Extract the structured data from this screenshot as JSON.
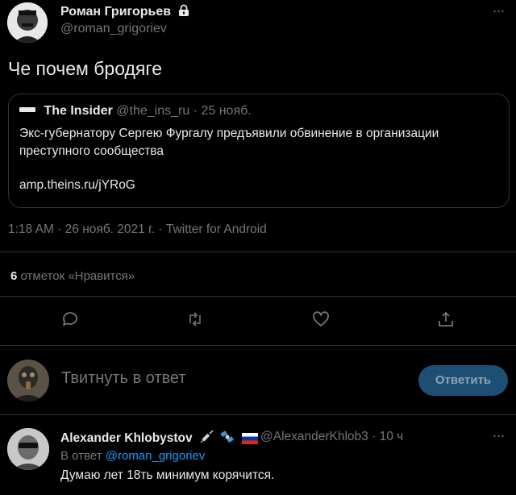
{
  "tweet": {
    "author_name": "Роман Григорьев",
    "author_handle": "@roman_grigoriev",
    "text": "Че почем бродяге",
    "quote": {
      "name": "The Insider",
      "handle": "@the_ins_ru",
      "date": "25 нояб.",
      "text": "Экс-губернатору Сергею Фургалу предъявили обвинение в организации преступного сообщества",
      "link": "amp.theins.ru/jYRoG"
    },
    "timestamp": "1:18 AM · 26 нояб. 2021 г. · Twitter for Android",
    "likes_count": "6",
    "likes_label": "отметок «Нравится»",
    "icons": {
      "lock": "lock-icon",
      "more": "more-icon",
      "reply": "reply-icon",
      "retweet": "retweet-icon",
      "like": "like-icon",
      "share": "share-icon"
    }
  },
  "composer": {
    "placeholder": "Твитнуть в ответ",
    "button_label": "Ответить",
    "button_color": "#1d4f74"
  },
  "reply": {
    "author_name": "Alexander Khlobystov",
    "author_handle": "@AlexanderKhlob3",
    "time": "10 ч",
    "reply_to_prefix": "В ответ",
    "reply_to_handle": "@roman_grigoriev",
    "text": "Думаю лет 18ть минимум корячится.",
    "emojis": [
      "syringe-emoji",
      "satellite-emoji",
      "russia-flag-emoji"
    ]
  },
  "colors": {
    "background": "#000000",
    "text": "#e7e9ea",
    "secondary": "#71767b",
    "link": "#1d9bf0",
    "border": "#2f3336"
  }
}
